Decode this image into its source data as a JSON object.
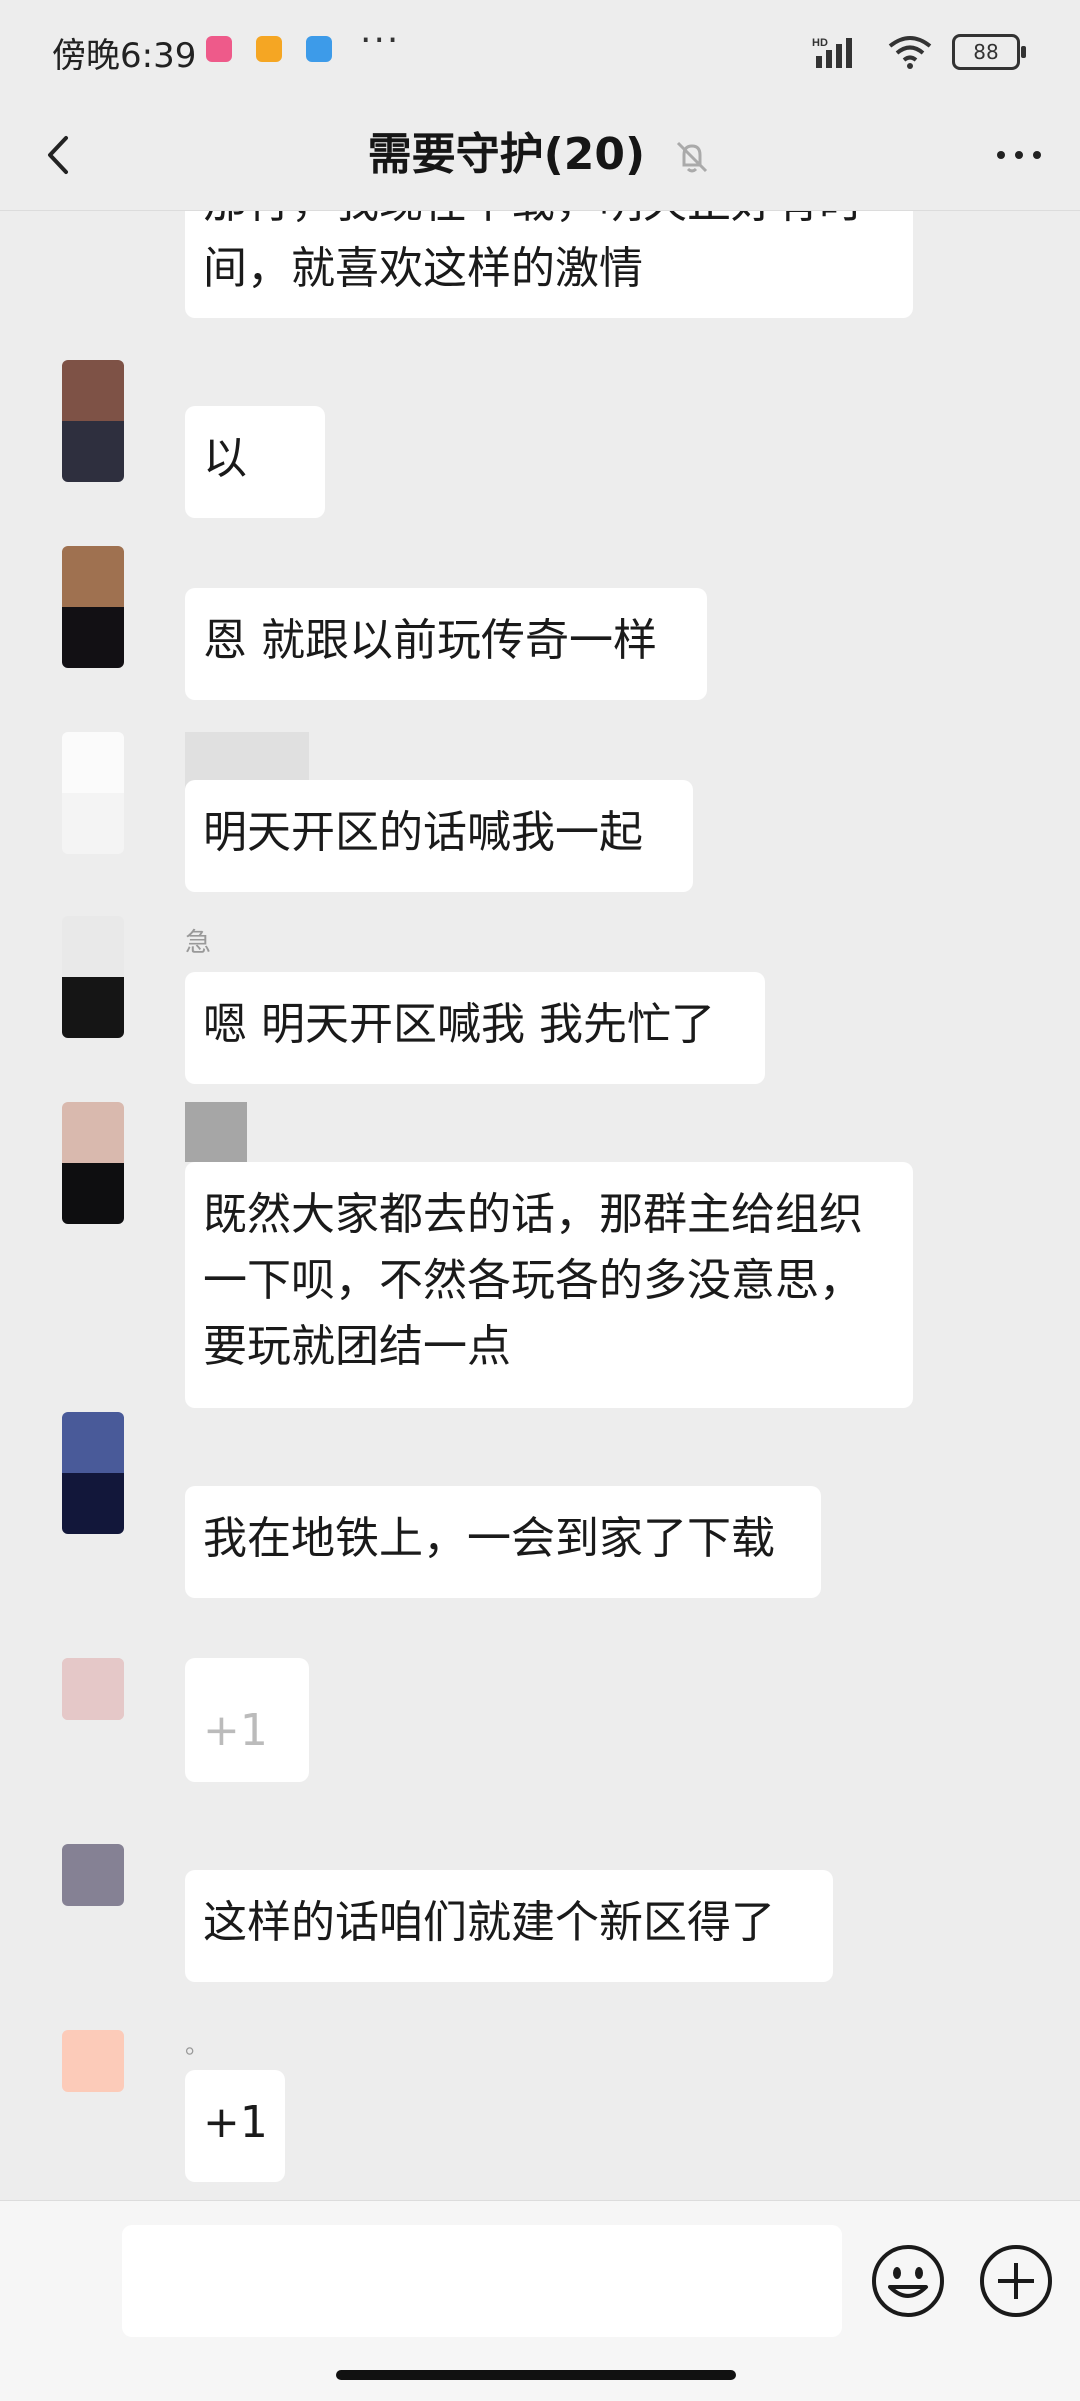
{
  "status_bar": {
    "time": "傍晚6:39",
    "more_dots": "···",
    "network": "HD",
    "battery": "88"
  },
  "header": {
    "title": "需要守护(20)"
  },
  "messages": [
    {
      "text": "那行，我现在下载，明天正好有时间，就喜欢这样的激情",
      "avatar_colors": [
        "#dcdcdc",
        "#c9c9c9"
      ]
    },
    {
      "text": "以",
      "avatar_colors": [
        "#7e5246",
        "#2e2f3e"
      ]
    },
    {
      "text": "恩 就跟以前玩传奇一样",
      "avatar_colors": [
        "#9f7150",
        "#121014"
      ]
    },
    {
      "text": "明天开区的话喊我一起",
      "avatar_colors": [
        "#fbfbfb",
        "#f4f4f4"
      ]
    },
    {
      "nick": "急",
      "text": "嗯 明天开区喊我 我先忙了",
      "avatar_colors": [
        "#e9e9e9",
        "#151515"
      ]
    },
    {
      "text": "既然大家都去的话，那群主给组织一下呗，不然各玩各的多没意思，要玩就团结一点",
      "avatar_colors": [
        "#d9b9ae",
        "#0e0e10"
      ]
    },
    {
      "text": "我在地铁上，一会到家了下载",
      "avatar_colors": [
        "#495a99",
        "#12173a"
      ]
    },
    {
      "text": "+1",
      "avatar_colors": [
        "#e5c8c8",
        "#e5c8c8"
      ]
    },
    {
      "text": "这样的话咱们就建个新区得了",
      "avatar_colors": [
        "#858194",
        "#858194"
      ]
    },
    {
      "nick": "。",
      "text": "+1",
      "avatar_colors": [
        "#fccbb9",
        "#fccbb9"
      ]
    }
  ],
  "input": {
    "value": "",
    "placeholder": ""
  },
  "colors": {
    "background": "#ededed",
    "bubble": "#ffffff",
    "input_bar": "#f6f6f6"
  }
}
